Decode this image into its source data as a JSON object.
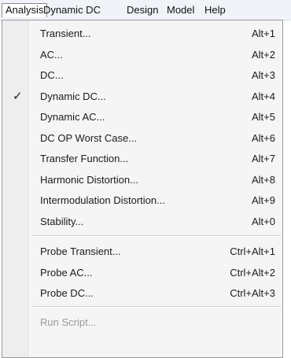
{
  "menubar": {
    "items": [
      {
        "label": "Analysis"
      },
      {
        "label": "Dynamic DC"
      },
      {
        "label": "Design"
      },
      {
        "label": "Model"
      },
      {
        "label": "Help"
      }
    ]
  },
  "menu": {
    "items": [
      {
        "label": "Transient...",
        "shortcut": "Alt+1"
      },
      {
        "label": "AC...",
        "shortcut": "Alt+2"
      },
      {
        "label": "DC...",
        "shortcut": "Alt+3"
      },
      {
        "label": "Dynamic DC...",
        "shortcut": "Alt+4",
        "checked": true,
        "check_icon": "check-icon"
      },
      {
        "label": "Dynamic AC...",
        "shortcut": "Alt+5"
      },
      {
        "label": "DC OP Worst Case...",
        "shortcut": "Alt+6"
      },
      {
        "label": "Transfer Function...",
        "shortcut": "Alt+7"
      },
      {
        "label": "Harmonic Distortion...",
        "shortcut": "Alt+8"
      },
      {
        "label": "Intermodulation Distortion...",
        "shortcut": "Alt+9"
      },
      {
        "label": "Stability...",
        "shortcut": "Alt+0"
      },
      {
        "label": "Probe Transient...",
        "shortcut": "Ctrl+Alt+1"
      },
      {
        "label": "Probe AC...",
        "shortcut": "Ctrl+Alt+2"
      },
      {
        "label": "Probe DC...",
        "shortcut": "Ctrl+Alt+3"
      },
      {
        "label": "Run Script...",
        "shortcut": "",
        "disabled": true
      }
    ]
  },
  "colors": {
    "menubar_bg": "#f0f3f8",
    "menu_bg": "#f5f5f5",
    "disabled_text": "#9a9a9a"
  }
}
